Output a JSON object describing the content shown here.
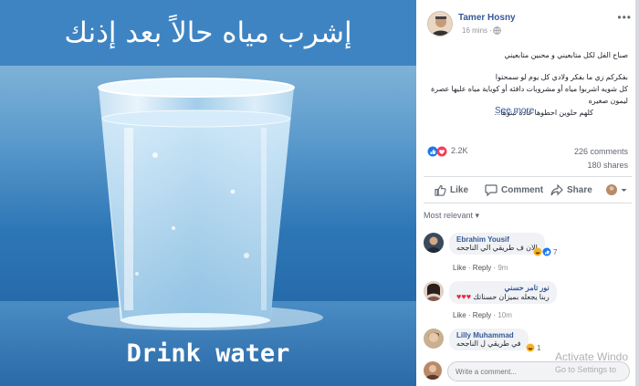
{
  "photo": {
    "headline": "إشرب مياه حالاً بعد إذنك",
    "caption": "Drink water"
  },
  "post": {
    "author": "Tamer Hosny",
    "time": "16 mins",
    "separator": "·",
    "more_icon": "ellipsis-icon",
    "text_lines": [
      "صباح الفل لكل متابعيني و محبين متابعيني",
      "بفكركم زي ما بفكر ولادي كل يوم لو سمحتوا",
      "كل شويه اشربوا مياه أو مشروبات دافئه أو كوباية مياه عليها عصرة",
      "ليمون صغيره",
      "كلهم حلوين احطوها عاده ثبتوها..."
    ],
    "see_more": "See more",
    "reactions": {
      "icons": [
        "like",
        "love"
      ],
      "count": "2.2K"
    },
    "comments_count": "226 comments",
    "shares_count": "180 shares",
    "actions": {
      "like": "Like",
      "comment": "Comment",
      "share": "Share"
    },
    "comment_filter": "Most relevant",
    "colors": {
      "link": "#365899",
      "like_blue": "#1877f2",
      "love_red": "#f33e58"
    }
  },
  "comments": [
    {
      "name": "Ebrahim Yousif",
      "text": "الان ف طريقي الي الناجحه",
      "reaction_count": "7",
      "like": "Like",
      "reply": "Reply",
      "time": "9m"
    },
    {
      "name": "نور تامر حسني",
      "text": "ربنا يجعله بميزان حسناتك",
      "hearts": 3,
      "like": "Like",
      "reply": "Reply",
      "time": "10m"
    },
    {
      "name": "Lilly Muhammad",
      "text": "في طريقي ل الناجحه",
      "reaction_count": "1"
    }
  ],
  "composer": {
    "placeholder": "Write a comment..."
  },
  "watermark": {
    "line1": "Activate Windo",
    "line2": "Go to Settings to"
  }
}
